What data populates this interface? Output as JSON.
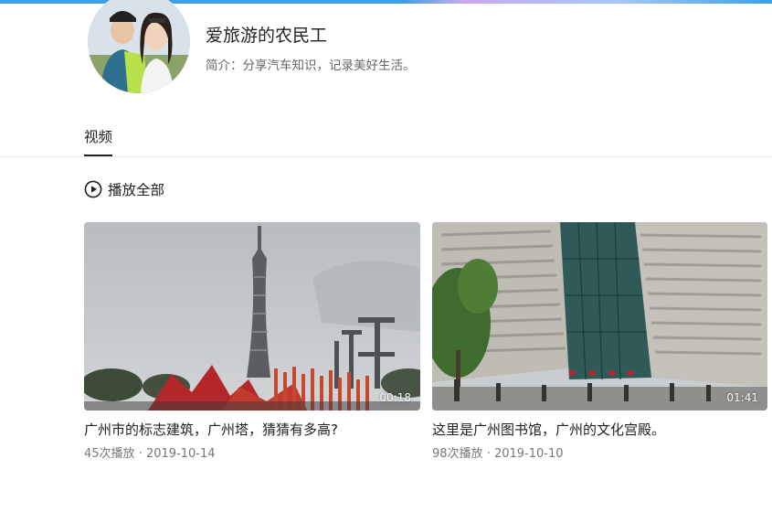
{
  "profile": {
    "name": "爱旅游的农民工",
    "bio": "简介：分享汽车知识，记录美好生活。"
  },
  "tabs": [
    {
      "label": "视频",
      "active": true
    }
  ],
  "play_all": {
    "label": "播放全部",
    "icon": "play-circle-icon"
  },
  "videos": [
    {
      "title": "广州市的标志建筑，广州塔，猜猜有多高?",
      "views": "45次播放",
      "date": "2019-10-14",
      "separator": "·",
      "duration": "00:18"
    },
    {
      "title": "这里是广州图书馆，广州的文化宫殿。",
      "views": "98次播放",
      "date": "2019-10-10",
      "separator": "·",
      "duration": "01:41"
    }
  ],
  "colors": {
    "accent_bar": "#3aa0e8",
    "text_primary": "#222222",
    "text_secondary": "#777777"
  }
}
